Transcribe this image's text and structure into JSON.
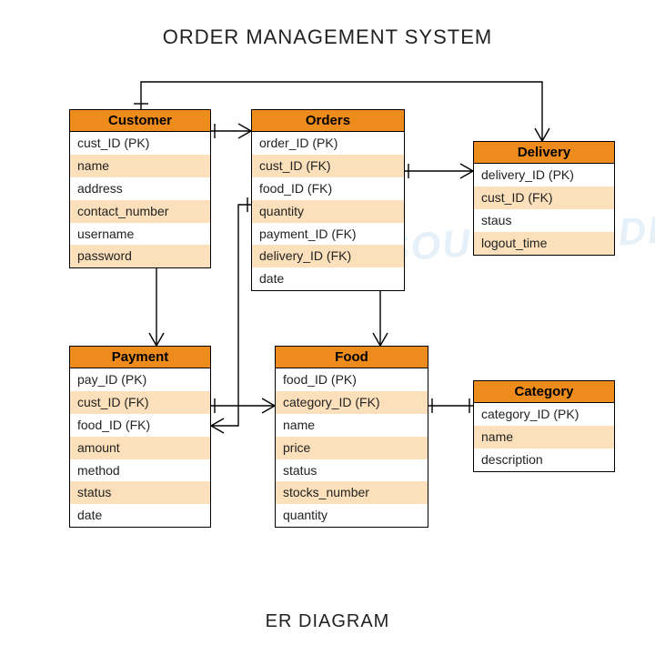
{
  "title": "ORDER MANAGEMENT SYSTEM",
  "subtitle": "ER DIAGRAM",
  "entities": {
    "customer": {
      "name": "Customer",
      "fields": [
        "cust_ID (PK)",
        "name",
        "address",
        "contact_number",
        "username",
        "password"
      ]
    },
    "orders": {
      "name": "Orders",
      "fields": [
        "order_ID (PK)",
        "cust_ID (FK)",
        "food_ID (FK)",
        "quantity",
        "payment_ID (FK)",
        "delivery_ID (FK)",
        "date"
      ]
    },
    "delivery": {
      "name": "Delivery",
      "fields": [
        "delivery_ID (PK)",
        "cust_ID (FK)",
        "staus",
        "logout_time"
      ]
    },
    "payment": {
      "name": "Payment",
      "fields": [
        "pay_ID (PK)",
        "cust_ID (FK)",
        "food_ID (FK)",
        "amount",
        "method",
        "status",
        "date"
      ]
    },
    "food": {
      "name": "Food",
      "fields": [
        "food_ID (PK)",
        "category_ID (FK)",
        "name",
        "price",
        "status",
        "stocks_number",
        "quantity"
      ]
    },
    "category": {
      "name": "Category",
      "fields": [
        "category_ID (PK)",
        "name",
        "description"
      ]
    }
  }
}
